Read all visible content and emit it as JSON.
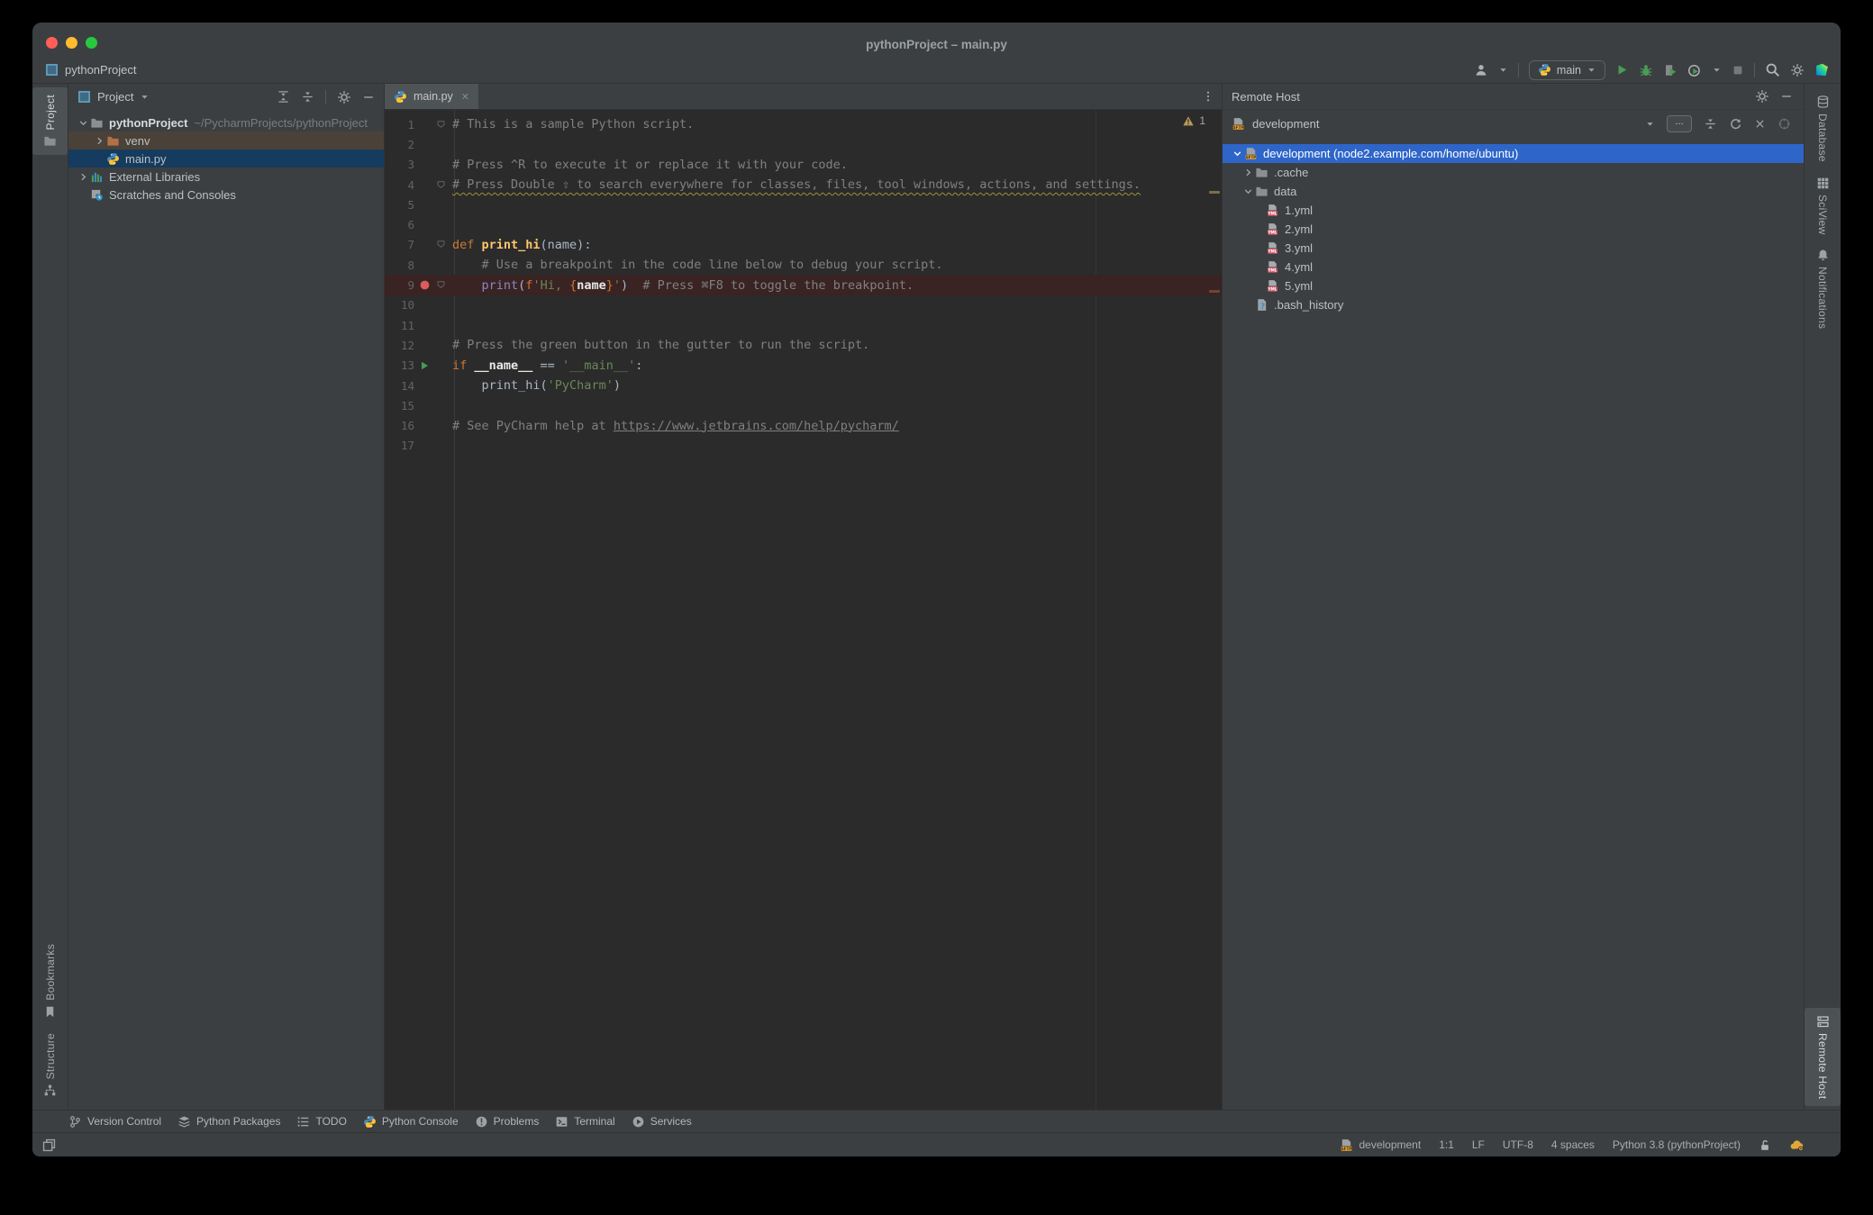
{
  "window": {
    "title": "pythonProject – main.py"
  },
  "navbar": {
    "project": "pythonProject",
    "run_config": "main",
    "right_icons": [
      "user",
      "caret",
      "run-config",
      "play",
      "debug",
      "coverage",
      "profiler",
      "caret",
      "stop",
      "search",
      "gear",
      "jetbrains"
    ]
  },
  "left_stripe": {
    "top": [
      {
        "icon": "folder",
        "label": "Project",
        "active": true
      }
    ],
    "bottom": [
      {
        "icon": "bookmark",
        "label": "Bookmarks"
      },
      {
        "icon": "structure",
        "label": "Structure"
      }
    ]
  },
  "right_stripe": {
    "top": [
      {
        "icon": "database",
        "label": "Database"
      },
      {
        "icon": "sciview",
        "label": "SciView"
      },
      {
        "icon": "bell",
        "label": "Notifications"
      }
    ],
    "bottom": [
      {
        "icon": "remote",
        "label": "Remote Host",
        "active": true
      }
    ]
  },
  "project_panel": {
    "title": "Project",
    "header_icons": [
      "collapse-blocks",
      "collapse-all",
      "gear",
      "minus"
    ],
    "tree": [
      {
        "level": 0,
        "chevron": "down",
        "icon": "folder",
        "label": "pythonProject",
        "bold": true,
        "suffix": "~/PycharmProjects/pythonProject"
      },
      {
        "level": 1,
        "chevron": "right",
        "icon": "folder-orange",
        "label": "venv",
        "row": "excluded"
      },
      {
        "level": 1,
        "chevron": null,
        "icon": "python",
        "label": "main.py",
        "row": "selected"
      },
      {
        "level": 0,
        "chevron": "right",
        "icon": "library",
        "label": "External Libraries"
      },
      {
        "level": 0,
        "chevron": null,
        "icon": "scratches",
        "label": "Scratches and Consoles"
      }
    ]
  },
  "editor": {
    "tab": "main.py",
    "warning_count": "1",
    "lines": [
      {
        "n": 1,
        "fold": true,
        "seg": [
          [
            "c",
            "# This is a sample Python script."
          ]
        ]
      },
      {
        "n": 2,
        "seg": []
      },
      {
        "n": 3,
        "seg": [
          [
            "c",
            "# Press ^R to execute it or replace it with your code."
          ]
        ]
      },
      {
        "n": 4,
        "fold": true,
        "seg": [
          [
            "ty",
            "# Press Double ⇧ to search everywhere for classes, files, tool windows, actions, and settings."
          ]
        ]
      },
      {
        "n": 5,
        "seg": []
      },
      {
        "n": 6,
        "seg": []
      },
      {
        "n": 7,
        "fold": true,
        "seg": [
          [
            "k",
            "def "
          ],
          [
            "f",
            "print_hi"
          ],
          [
            "p",
            "(name):"
          ]
        ]
      },
      {
        "n": 8,
        "seg": [
          [
            "c",
            "    # Use a breakpoint in the code line below to debug your script."
          ]
        ]
      },
      {
        "n": 9,
        "mark": "breakpoint",
        "fold": true,
        "hl": true,
        "seg": [
          [
            "p",
            "    "
          ],
          [
            "b",
            "print"
          ],
          [
            "p",
            "("
          ],
          [
            "k",
            "f"
          ],
          [
            "s",
            "'Hi, "
          ],
          [
            "br",
            "{"
          ],
          [
            "w",
            "name"
          ],
          [
            "br",
            "}"
          ],
          [
            "s",
            "'"
          ],
          [
            "p",
            ")"
          ],
          [
            "c",
            "  # Press ⌘F8 to toggle the breakpoint."
          ]
        ]
      },
      {
        "n": 10,
        "seg": []
      },
      {
        "n": 11,
        "seg": []
      },
      {
        "n": 12,
        "seg": [
          [
            "c",
            "# Press the green button in the gutter to run the script."
          ]
        ]
      },
      {
        "n": 13,
        "mark": "run",
        "seg": [
          [
            "k",
            "if "
          ],
          [
            "w",
            "__name__"
          ],
          [
            "p",
            " == "
          ],
          [
            "s",
            "'__main__'"
          ],
          [
            "p",
            ":"
          ]
        ]
      },
      {
        "n": 14,
        "seg": [
          [
            "p",
            "    print_hi("
          ],
          [
            "s",
            "'PyCharm'"
          ],
          [
            "p",
            ")"
          ]
        ]
      },
      {
        "n": 15,
        "seg": []
      },
      {
        "n": 16,
        "seg": [
          [
            "c",
            "# See PyCharm help at "
          ],
          [
            "lk",
            "https://www.jetbrains.com/help/pycharm/"
          ]
        ]
      },
      {
        "n": 17,
        "seg": []
      }
    ]
  },
  "remote_panel": {
    "title": "Remote Host",
    "server": "development",
    "browse_label": "...",
    "toolbar_icons": [
      "caret",
      "browse",
      "collapse-all",
      "refresh",
      "close",
      "target"
    ],
    "tree": [
      {
        "level": 0,
        "chevron": "down",
        "icon": "sftp",
        "label": "development (node2.example.com/home/ubuntu)",
        "row": "selected-blue"
      },
      {
        "level": 1,
        "chevron": "right",
        "icon": "folder",
        "label": ".cache"
      },
      {
        "level": 1,
        "chevron": "down",
        "icon": "folder",
        "label": "data"
      },
      {
        "level": 2,
        "chevron": null,
        "icon": "yml",
        "label": "1.yml"
      },
      {
        "level": 2,
        "chevron": null,
        "icon": "yml",
        "label": "2.yml"
      },
      {
        "level": 2,
        "chevron": null,
        "icon": "yml",
        "label": "3.yml"
      },
      {
        "level": 2,
        "chevron": null,
        "icon": "yml",
        "label": "4.yml"
      },
      {
        "level": 2,
        "chevron": null,
        "icon": "yml",
        "label": "5.yml"
      },
      {
        "level": 1,
        "chevron": null,
        "icon": "unknown-file",
        "label": ".bash_history"
      }
    ]
  },
  "toolbar_bottom": {
    "items": [
      {
        "icon": "branch",
        "label": "Version Control"
      },
      {
        "icon": "layers",
        "label": "Python Packages"
      },
      {
        "icon": "todo",
        "label": "TODO"
      },
      {
        "icon": "python",
        "label": "Python Console"
      },
      {
        "icon": "problems",
        "label": "Problems"
      },
      {
        "icon": "terminal",
        "label": "Terminal"
      },
      {
        "icon": "services",
        "label": "Services"
      }
    ]
  },
  "status_bar": {
    "items": [
      {
        "icon": "sftp",
        "label": "development"
      },
      {
        "label": "1:1"
      },
      {
        "label": "LF"
      },
      {
        "label": "UTF-8"
      },
      {
        "label": "4 spaces"
      },
      {
        "label": "Python 3.8 (pythonProject)"
      },
      {
        "icon": "lock-open"
      },
      {
        "icon": "cloud"
      }
    ]
  },
  "colors": {
    "accent": "#2e65c9",
    "panel": "#3c3f41",
    "editor": "#2b2b2b",
    "selection_inactive": "#153b5e",
    "excluded_row": "#4a4238",
    "breakpoint_line": "#3a2323",
    "breakpoint_red": "#db5c5c",
    "run_green": "#499c54",
    "keyword_orange": "#cc7832",
    "string_green": "#6a8759",
    "function_yellow": "#ffc66d",
    "builtin_purple": "#8888c6",
    "comment_gray": "#808080",
    "traffic_red": "#ff5f57",
    "traffic_yellow": "#febc2e",
    "traffic_green": "#28c840"
  }
}
